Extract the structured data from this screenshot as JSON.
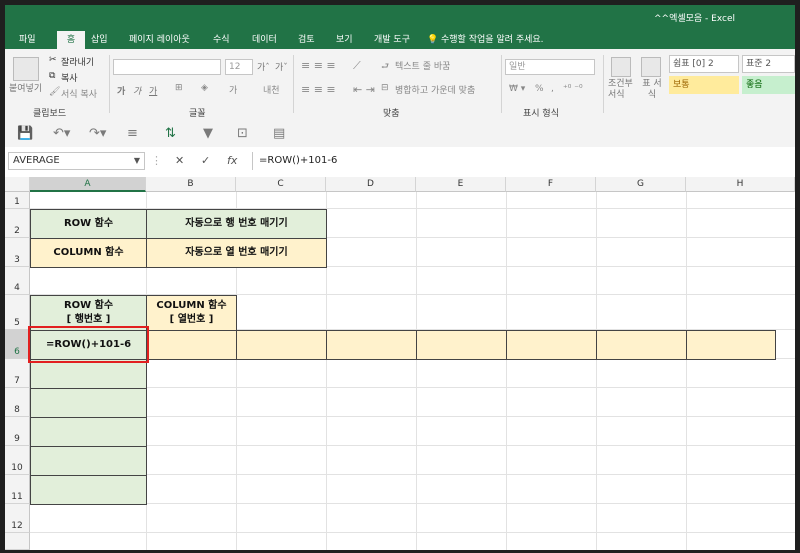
{
  "app": {
    "title": "^^엑셀모음 - Excel"
  },
  "tabs": [
    "파일",
    "홈",
    "삽입",
    "페이지 레이아웃",
    "수식",
    "데이터",
    "검토",
    "보기",
    "개발 도구"
  ],
  "tell_me": "수행할 작업을 알려 주세요.",
  "ribbon": {
    "clipboard": {
      "paste": "붙여넣기",
      "cut": "잘라내기",
      "copy": "복사",
      "format_painter": "서식 복사",
      "label": "클립보드"
    },
    "font": {
      "size": "12",
      "bold": "가",
      "italic": "가",
      "underline": "가",
      "label": "글꼴",
      "phonetic": "내천"
    },
    "alignment": {
      "wrap": "텍스트 줄 바꿈",
      "merge": "병합하고 가운데 맞춤",
      "label": "맞춤"
    },
    "number": {
      "format": "일반",
      "percent": "%",
      "comma": ",",
      "label": "표시 형식"
    },
    "styles": {
      "conditional": "조건부 서식",
      "table": "표 서식",
      "style1": "쉼표 [0] 2",
      "style2": "표준 2",
      "style3": "보통",
      "style4": "좋음"
    }
  },
  "formula_bar": {
    "name_box": "AVERAGE",
    "formula": "=ROW()+101-6",
    "fx": "fx"
  },
  "columns": [
    "A",
    "B",
    "C",
    "D",
    "E",
    "F",
    "G",
    "H"
  ],
  "rows": [
    "1",
    "2",
    "3",
    "4",
    "5",
    "6",
    "7",
    "8",
    "9",
    "10",
    "11",
    "12"
  ],
  "cells": {
    "a2": "ROW 함수",
    "b2": "자동으로 행 번호 매기기",
    "a3": "COLUMN 함수",
    "b3": "자동으로 열 번호 매기기",
    "a5_line1": "ROW 함수",
    "a5_line2": "[ 행번호 ]",
    "b5_line1": "COLUMN 함수",
    "b5_line2": "[ 열번호 ]",
    "a6": "=ROW()+101-6"
  },
  "colors": {
    "excel_green": "#217346",
    "green_fill": "#e2efda",
    "yellow_fill": "#fff2cc",
    "highlight_red": "#e21f1f"
  }
}
